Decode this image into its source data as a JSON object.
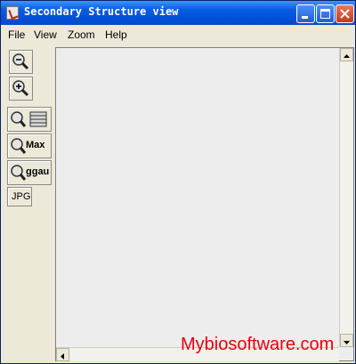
{
  "window": {
    "title": "Secondary Structure view"
  },
  "menu": [
    "File",
    "View",
    "Zoom",
    "Help"
  ],
  "toolbar": {
    "zoom_out_icon": "zoom-out-icon",
    "zoom_in_icon": "zoom-in-icon",
    "fit_icon": "zoom-fit-icon",
    "max_label": "Max",
    "ggau_label": "ggau",
    "jpg_label": "JPG"
  },
  "watermark": "Mybiosoftware.com"
}
